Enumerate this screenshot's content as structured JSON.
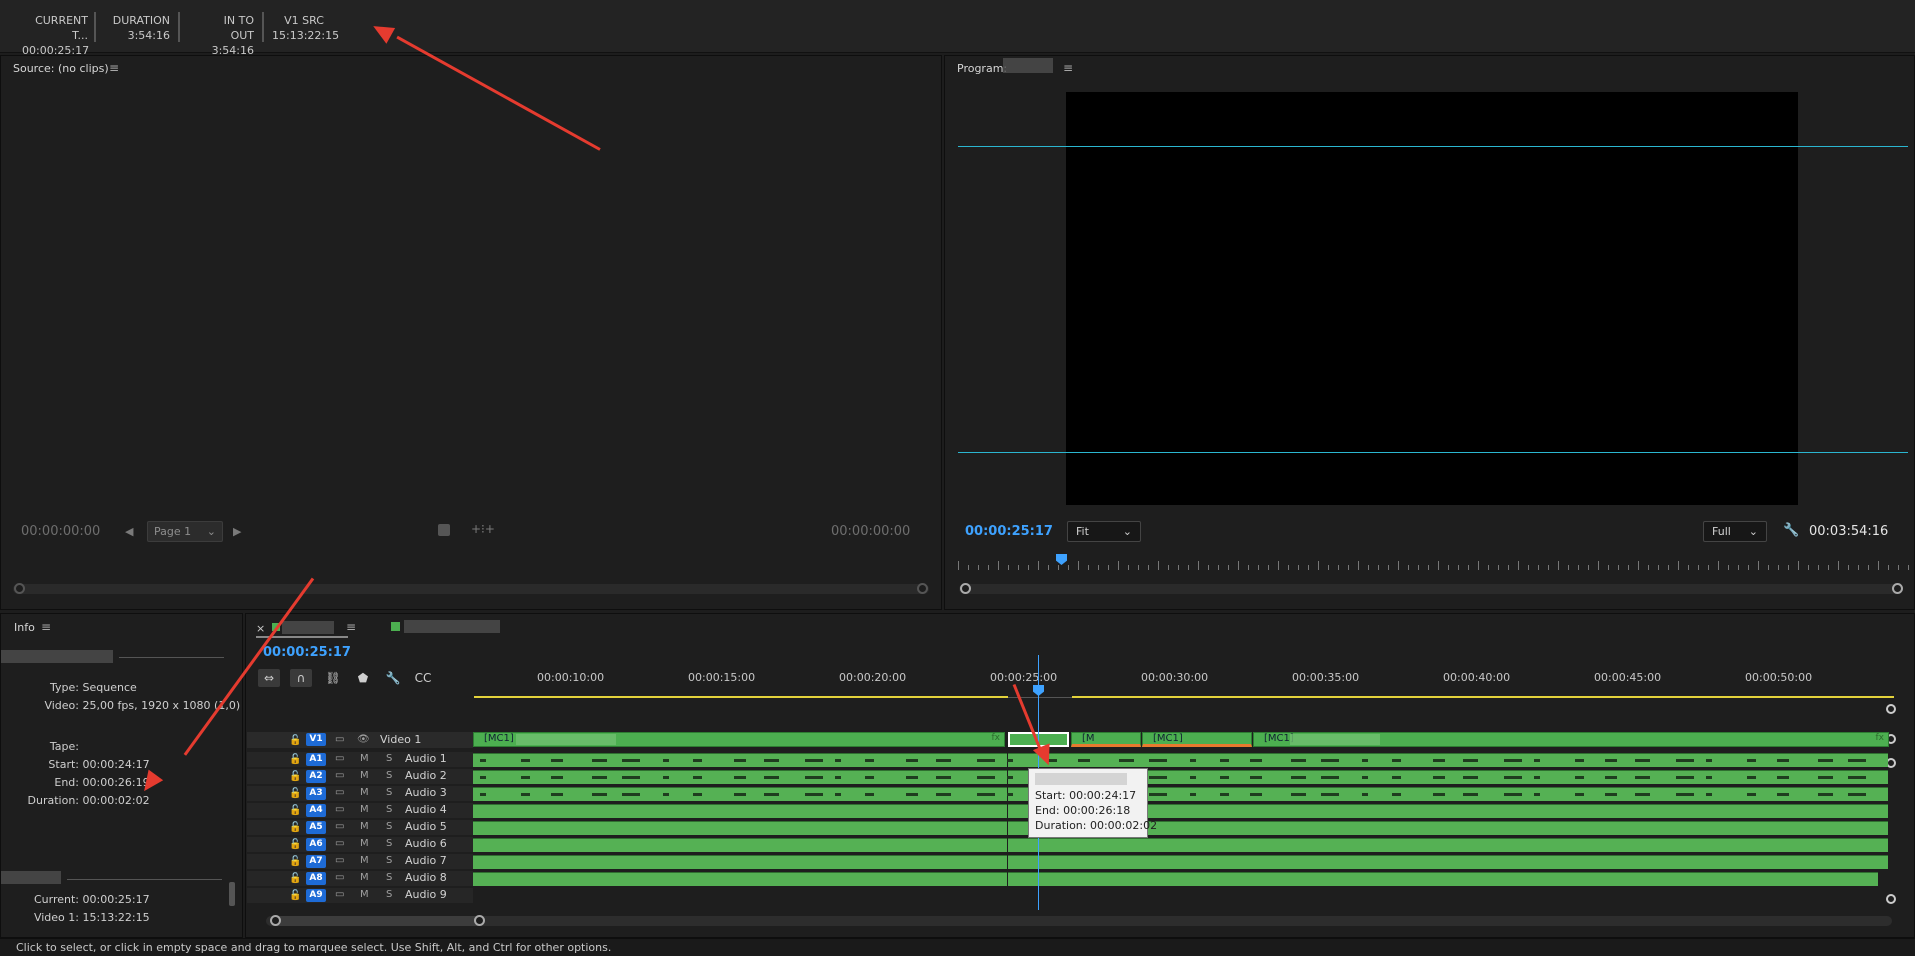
{
  "topbar": {
    "columns": [
      {
        "label": "CURRENT T...",
        "value": "00:00:25:17"
      },
      {
        "label": "DURATION",
        "value": "3:54:16"
      },
      {
        "label": "IN TO OUT",
        "value": "3:54:16"
      },
      {
        "label": "V1 SRC",
        "value": "15:13:22:15"
      }
    ]
  },
  "source": {
    "title": "Source: (no clips)",
    "menu": "≡",
    "tc_left": "00:00:00:00",
    "tc_right": "00:00:00:00",
    "page_select": "Page 1"
  },
  "program": {
    "title": "Program:",
    "menu": "≡",
    "tc_current": "00:00:25:17",
    "fit_select": "Fit",
    "full_select": "Full",
    "tc_duration": "00:03:54:16"
  },
  "info": {
    "title": "Info",
    "menu": "≡",
    "type_label": "Type:",
    "type_value": "Sequence",
    "video_label": "Video:",
    "video_value": "25,00 fps, 1920 x 1080 (1,0)",
    "tape_label": "Tape:",
    "start_label": "Start:",
    "start_value": "00:00:24:17",
    "end_label": "End:",
    "end_value": "00:00:26:19",
    "duration_label": "Duration:",
    "duration_value": "00:00:02:02",
    "current_label": "Current:",
    "current_value": "00:00:25:17",
    "video1_label": "Video 1:",
    "video1_value": "15:13:22:15"
  },
  "timeline": {
    "close": "×",
    "menu": "≡",
    "tc": "00:00:25:17",
    "ruler_labels": [
      "00:00:10:00",
      "00:00:15:00",
      "00:00:20:00",
      "00:00:25:00",
      "00:00:30:00",
      "00:00:35:00",
      "00:00:40:00",
      "00:00:45:00",
      "00:00:50:00"
    ],
    "video_track": {
      "badge": "V1",
      "name": "Video 1"
    },
    "audio_tracks": [
      {
        "badge": "A1",
        "name": "Audio 1"
      },
      {
        "badge": "A2",
        "name": "Audio 2"
      },
      {
        "badge": "A3",
        "name": "Audio 3"
      },
      {
        "badge": "A4",
        "name": "Audio 4"
      },
      {
        "badge": "A5",
        "name": "Audio 5"
      },
      {
        "badge": "A6",
        "name": "Audio 6"
      },
      {
        "badge": "A7",
        "name": "Audio 7"
      },
      {
        "badge": "A8",
        "name": "Audio 8"
      },
      {
        "badge": "A9",
        "name": "Audio 9"
      }
    ],
    "track_m": "M",
    "track_s": "S",
    "clips": [
      {
        "label": "[MC1]"
      },
      {
        "label": "[M"
      },
      {
        "label": "[MC1]"
      },
      {
        "label": "[MC1]"
      }
    ],
    "fx": "fx",
    "tooltip": {
      "start": "Start: 00:00:24:17",
      "end": "End: 00:00:26:18",
      "duration": "Duration: 00:00:02:02"
    }
  },
  "status": "Click to select, or click in empty space and drag to marquee select. Use Shift, Alt, and Ctrl for other options.",
  "colors": {
    "accent": "#3ea2ff",
    "clip_green": "#4caf50",
    "arrow": "#e53b2f",
    "guide": "#2bb6d0"
  }
}
